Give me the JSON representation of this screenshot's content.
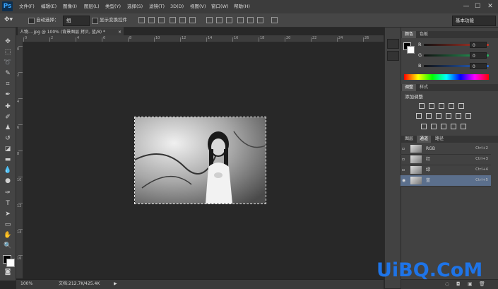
{
  "app": {
    "logo": "Ps"
  },
  "menu": [
    "文件(F)",
    "编辑(E)",
    "图像(I)",
    "图层(L)",
    "类型(Y)",
    "选择(S)",
    "滤镜(T)",
    "3D(D)",
    "视图(V)",
    "窗口(W)",
    "帮助(H)"
  ],
  "window_controls": {
    "minimize": "—",
    "maximize": "☐",
    "close": "✕"
  },
  "options": {
    "auto_select_label": "自动选择：",
    "auto_select_value": "组",
    "show_transform_label": "显示变换控件",
    "workspace": "基本功能"
  },
  "document": {
    "tab_title": "人物....jpg @ 100% (背景图层 拷贝, 蓝/8) *",
    "close": "×"
  },
  "ruler_top": [
    "0",
    "2",
    "4",
    "6",
    "8",
    "10",
    "12",
    "14",
    "16",
    "18",
    "20",
    "22",
    "24",
    "26"
  ],
  "ruler_left": [
    "0",
    "2",
    "4",
    "6",
    "8",
    "10",
    "12",
    "14",
    "16"
  ],
  "status": {
    "zoom": "100%",
    "doc_size": "文档:212.7K/425.4K"
  },
  "color_panel": {
    "tabs": [
      "颜色",
      "色板"
    ],
    "channels": [
      {
        "label": "R",
        "value": "0",
        "color": "#c0392b"
      },
      {
        "label": "G",
        "value": "0",
        "color": "#27ae60"
      },
      {
        "label": "B",
        "value": "0",
        "color": "#2a6ad6"
      }
    ]
  },
  "adjust_panel": {
    "tabs": [
      "调整",
      "样式"
    ],
    "title": "添加调整"
  },
  "channels_panel": {
    "tabs": [
      "图层",
      "通道",
      "路径"
    ],
    "rows": [
      {
        "name": "RGB",
        "shortcut": "Ctrl+2",
        "selected": false
      },
      {
        "name": "红",
        "shortcut": "Ctrl+3",
        "selected": false
      },
      {
        "name": "绿",
        "shortcut": "Ctrl+4",
        "selected": false
      },
      {
        "name": "蓝",
        "shortcut": "Ctrl+5",
        "selected": true
      }
    ]
  },
  "colors": {
    "accent": "#1e74e8",
    "selected_row": "#5b6f8c"
  },
  "watermark": "UiBQ.CoM"
}
